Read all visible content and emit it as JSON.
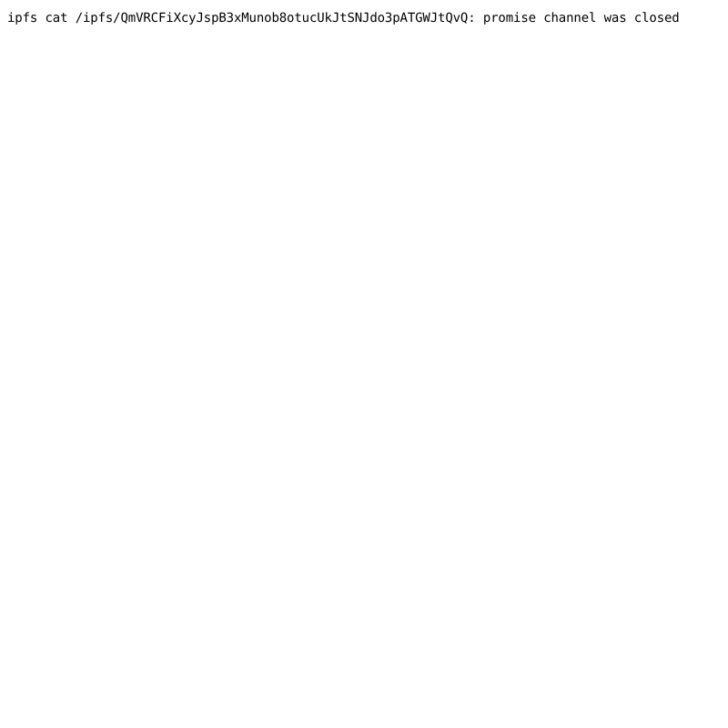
{
  "page": {
    "background_color": "#ffffff",
    "text_color": "#000000",
    "content_type": "plain-text-error-output"
  },
  "output": {
    "full_line": "ipfs cat /ipfs/QmVRCFiXcyJspB3xMunob8otucUkJtSNJdo3pATGWJtQvQ: promise channel was closed",
    "command": "ipfs cat",
    "path": "/ipfs/QmVRCFiXcyJspB3xMunob8otucUkJtSNJdo3pATGWJtQvQ",
    "cid": "QmVRCFiXcyJspB3xMunob8otucUkJtSNJdo3pATGWJtQvQ",
    "separator": ": ",
    "error_message": "promise channel was closed"
  }
}
